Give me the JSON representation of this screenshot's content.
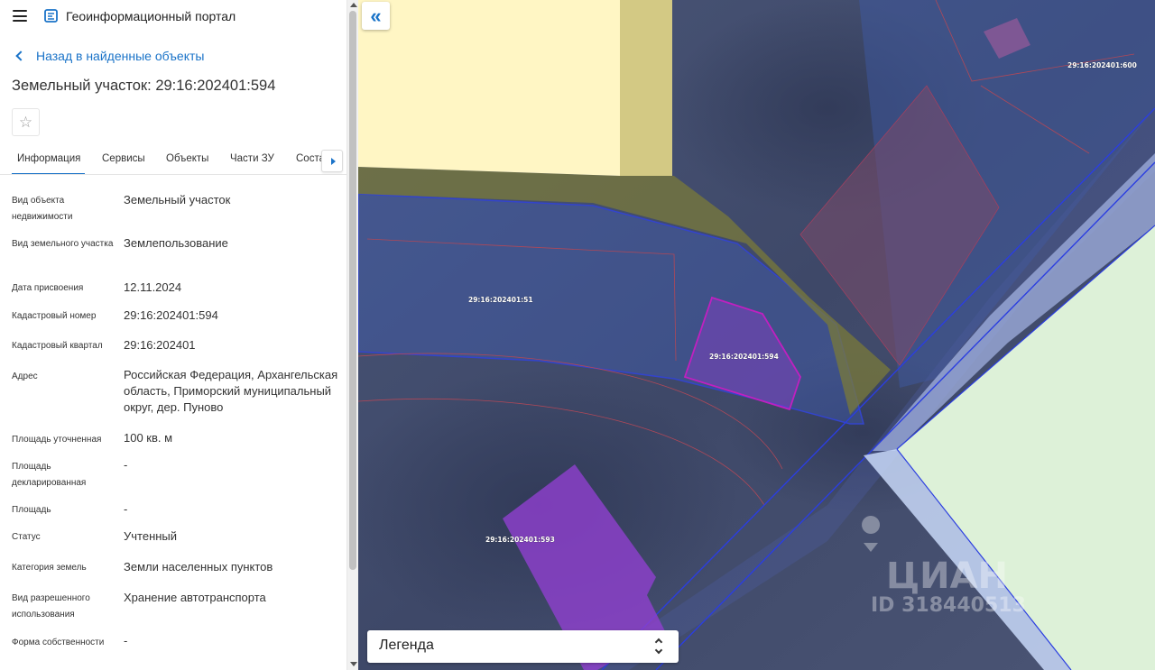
{
  "header": {
    "app_title": "Геоинформационный портал"
  },
  "back_link": "Назад в найденные объекты",
  "object_title": "Земельный участок: 29:16:202401:594",
  "tabs": [
    {
      "label": "Информация"
    },
    {
      "label": "Сервисы"
    },
    {
      "label": "Объекты"
    },
    {
      "label": "Части ЗУ"
    },
    {
      "label": "Соста"
    }
  ],
  "fields": [
    {
      "label": "Вид объекта недвижимости",
      "value": "Земельный участок"
    },
    {
      "label": "Вид земельного участка",
      "value": "Землепользование"
    },
    {
      "label": "Дата присвоения",
      "value": "12.11.2024"
    },
    {
      "label": "Кадастровый номер",
      "value": "29:16:202401:594"
    },
    {
      "label": "Кадастровый квартал",
      "value": "29:16:202401"
    },
    {
      "label": "Адрес",
      "value": "Российская Федерация, Архангельская область, Приморский муниципальный округ, дер. Пуново"
    },
    {
      "label": "Площадь уточненная",
      "value": "100 кв. м"
    },
    {
      "label": "Площадь декларированная",
      "value": "-"
    },
    {
      "label": "Площадь",
      "value": "-"
    },
    {
      "label": "Статус",
      "value": "Учтенный"
    },
    {
      "label": "Категория земель",
      "value": "Земли населенных пунктов"
    },
    {
      "label": "Вид разрешенного использования",
      "value": "Хранение автотранспорта"
    },
    {
      "label": "Форма собственности",
      "value": "-"
    }
  ],
  "map": {
    "parcel_labels": [
      "29:16:202401:51",
      "29:16:202401:594",
      "29:16:202401:593",
      "29:16:202401:600"
    ],
    "watermark": "ЦИАН",
    "watermark_id": "ID 318440513",
    "legend_label": "Легенда"
  },
  "colors": {
    "accent": "#1a73c8",
    "parcel_selected": "#9b3fd6",
    "zone_yellow": "#fff6c8",
    "zone_green": "#d9f0d6",
    "zone_blue": "#3a55b8"
  }
}
